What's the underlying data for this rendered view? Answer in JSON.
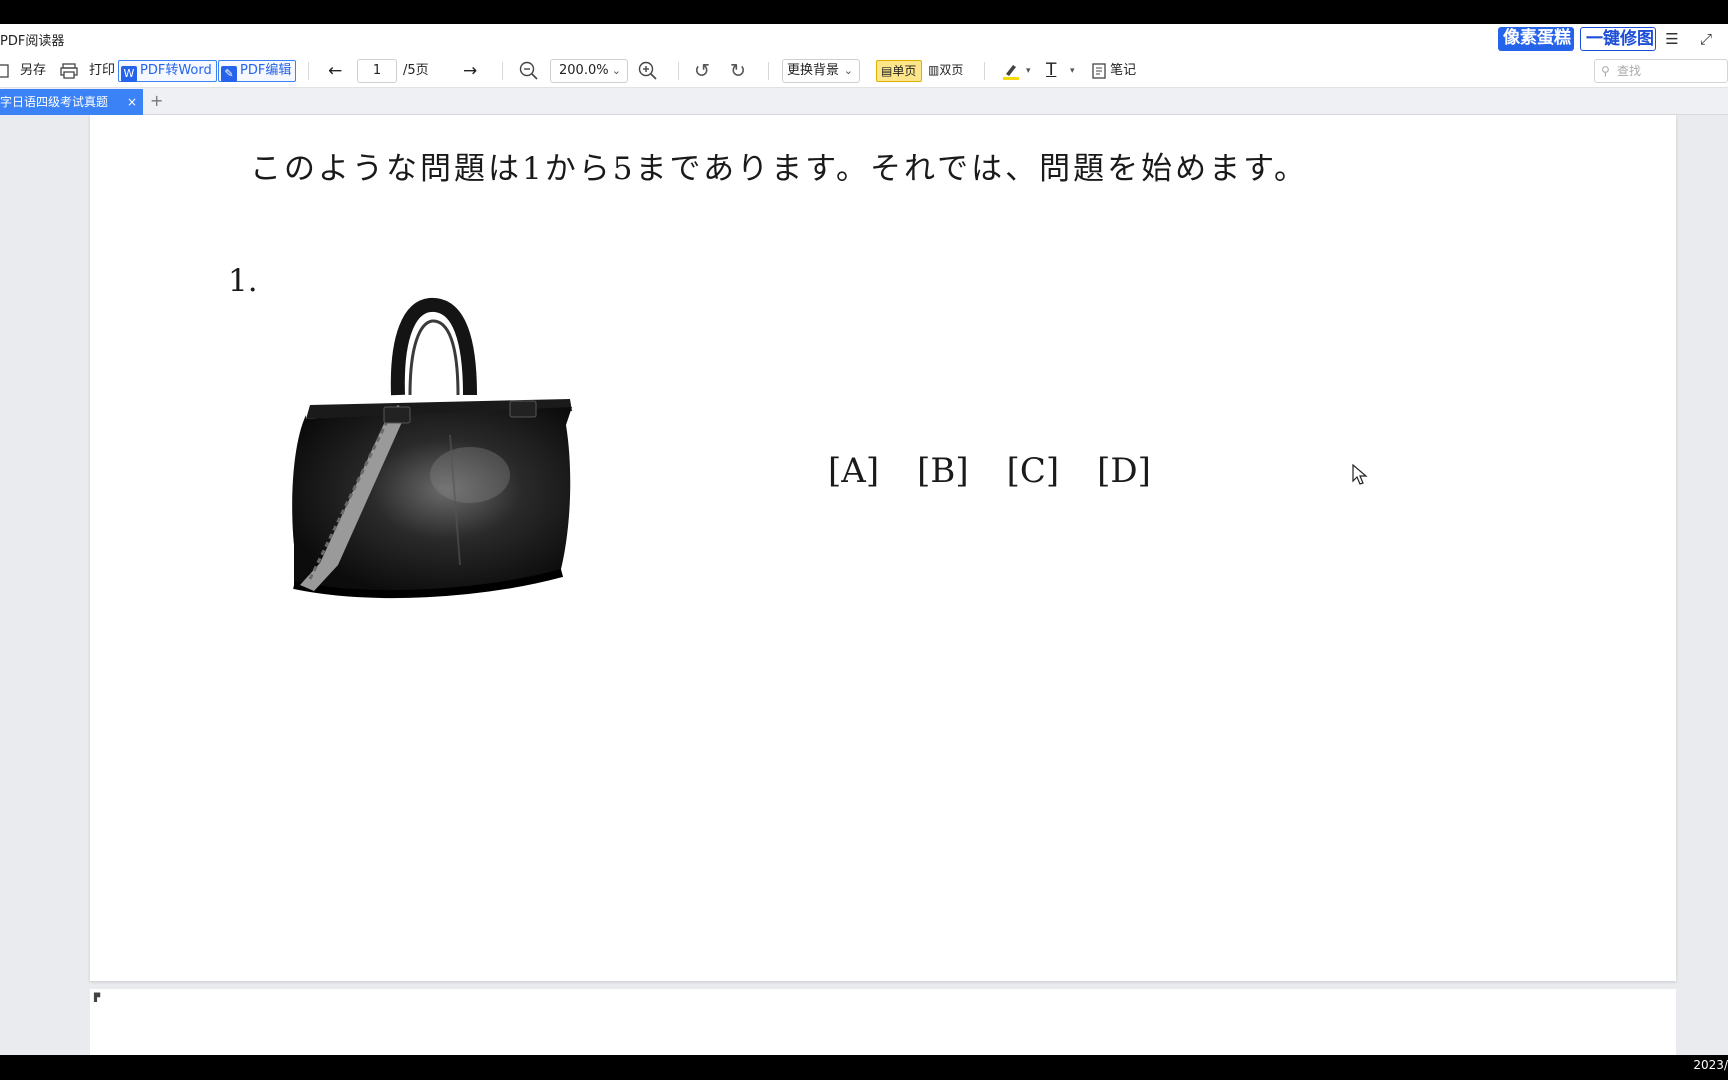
{
  "window": {
    "app_title": "PDF阅读器",
    "promo_pixel_cake": "像素蛋糕",
    "promo_one_click": "一键修图"
  },
  "toolbar": {
    "save_as": "另存",
    "print": "打印",
    "pdf_to_word": "PDF转Word",
    "pdf_edit": "PDF编辑",
    "current_page": "1",
    "total_pages": "/5页",
    "zoom_level": "200.0%",
    "change_background": "更换背景",
    "single_page": "单页",
    "double_page": "双页",
    "notes": "笔记",
    "search_placeholder": "查找"
  },
  "tabs": [
    {
      "label": "字日语四级考试真题",
      "active": true
    }
  ],
  "document": {
    "intro_line": "このような問題は1から5まであります。それでは、問題を始めます。",
    "question_number": "1.",
    "choices": [
      "[A]",
      "[B]",
      "[C]",
      "[D]"
    ]
  },
  "system": {
    "clock": "2023/"
  },
  "colors": {
    "accent": "#3b82f6",
    "active_toggle": "#fde68a",
    "doc_background": "#e9ebee"
  },
  "icons": [
    "save-as-icon",
    "print-icon",
    "word-icon",
    "edit-icon",
    "prev-page-icon",
    "next-page-icon",
    "zoom-out-icon",
    "zoom-in-icon",
    "rotate-left-icon",
    "rotate-right-icon",
    "highlight-icon",
    "text-icon",
    "note-icon",
    "search-icon",
    "menu-icon",
    "fullscreen-icon",
    "mouse-cursor-icon"
  ]
}
